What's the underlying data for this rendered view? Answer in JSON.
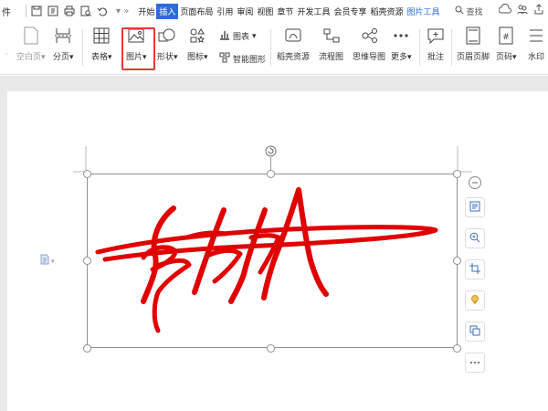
{
  "menubar": {
    "file_label": "件",
    "tabs": [
      {
        "label": "开始",
        "active": false
      },
      {
        "label": "插入",
        "active": true
      },
      {
        "label": "页面布局",
        "active": false
      },
      {
        "label": "引用",
        "active": false
      },
      {
        "label": "审阅",
        "active": false
      },
      {
        "label": "视图",
        "active": false
      },
      {
        "label": "章节",
        "active": false
      },
      {
        "label": "开发工具",
        "active": false
      },
      {
        "label": "会员专享",
        "active": false
      },
      {
        "label": "稻壳资源",
        "active": false
      },
      {
        "label": "图片工具",
        "active": false
      }
    ],
    "search_label": "查找"
  },
  "ribbon": {
    "blank_page": "空白页",
    "page_break": "分页",
    "table": "表格",
    "picture": "图片",
    "shape": "形状",
    "icon_lib": "图标",
    "chart": "图表",
    "smart_art": "智能图形",
    "docer": "稻壳资源",
    "flowchart": "流程图",
    "mindmap": "思维导图",
    "more": "更多",
    "comment": "批注",
    "header_footer": "页眉页脚",
    "page_number": "页码",
    "watermark": "水印"
  },
  "colors": {
    "accent": "#2f6bd8",
    "highlight_box": "#e53935",
    "signature": "#e00000"
  }
}
